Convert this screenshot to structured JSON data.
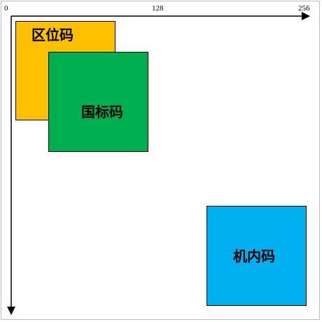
{
  "axis": {
    "ticks": [
      "0",
      "128",
      "256"
    ]
  },
  "boxes": [
    {
      "label": "区位码",
      "color": "#FFC000"
    },
    {
      "label": "国标码",
      "color": "#00B050"
    },
    {
      "label": "机内码",
      "color": "#00B0F0"
    }
  ]
}
